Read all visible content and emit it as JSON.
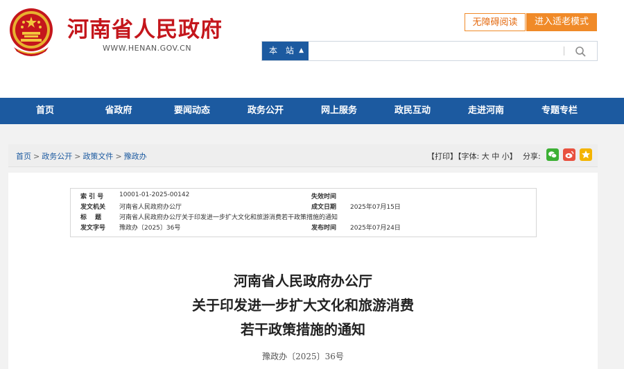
{
  "header": {
    "site_name": "河南省人民政府",
    "site_url": "WWW.HENAN.GOV.CN",
    "accessibility_label": "无障碍阅读",
    "elder_mode_label": "进入适老模式",
    "search": {
      "scope_label": "本 站",
      "placeholder": ""
    }
  },
  "nav": {
    "items": [
      "首页",
      "省政府",
      "要闻动态",
      "政务公开",
      "网上服务",
      "政民互动",
      "走进河南",
      "专题专栏"
    ]
  },
  "breadcrumb": {
    "items": [
      "首页",
      "政务公开",
      "政策文件",
      "豫政办"
    ],
    "separator": ">"
  },
  "toolbar": {
    "print_label": "【打印】",
    "font_label": "【字体:",
    "font_large": "大",
    "font_medium": "中",
    "font_small": "小",
    "font_close": "】",
    "share_label": "分享:"
  },
  "meta": {
    "index_label": "索 引 号",
    "index_value": "10001-01-2025-00142",
    "expire_label": "失效时间",
    "expire_value": "",
    "issuer_label": "发文机关",
    "issuer_value": "河南省人民政府办公厅",
    "date_label": "成文日期",
    "date_value": "2025年07月15日",
    "subject_label": "标　 题",
    "subject_value": "河南省人民政府办公厅关于印发进一步扩大文化和旅游消费若干政策措施的通知",
    "docnum_label": "发文字号",
    "docnum_value": "豫政办〔2025〕36号",
    "publish_label": "发布时间",
    "publish_value": "2025年07月24日"
  },
  "article": {
    "title_line1": "河南省人民政府办公厅",
    "title_line2": "关于印发进一步扩大文化和旅游消费",
    "title_line3": "若干政策措施的通知",
    "doc_number": "豫政办〔2025〕36号"
  },
  "colors": {
    "brand_red": "#c4161c",
    "nav_blue": "#1c5aa0",
    "accent_orange": "#f08a28"
  }
}
